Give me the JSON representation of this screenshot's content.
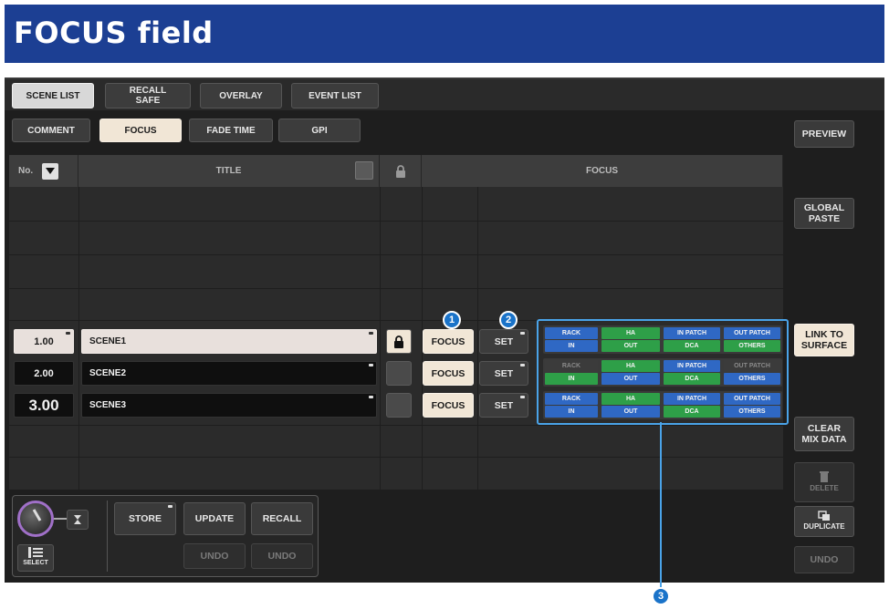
{
  "page_title": "FOCUS field",
  "tabs": [
    {
      "label": "SCENE LIST",
      "active": true
    },
    {
      "label": "RECALL\nSAFE",
      "active": false
    },
    {
      "label": "OVERLAY",
      "active": false
    },
    {
      "label": "EVENT LIST",
      "active": false
    }
  ],
  "subtabs": [
    {
      "label": "COMMENT",
      "active": false
    },
    {
      "label": "FOCUS",
      "active": true
    },
    {
      "label": "FADE TIME",
      "active": false
    },
    {
      "label": "GPI",
      "active": false
    }
  ],
  "table": {
    "col_no": "No.",
    "col_title": "TITLE",
    "col_focus": "FOCUS",
    "lock_icon": "lock-icon",
    "rows": [
      {
        "no": "1.00",
        "title": "SCENE1",
        "focus_btn": "FOCUS",
        "set_btn": "SET",
        "locked": true,
        "selected": true,
        "focus": {
          "RACK": true,
          "IN": true,
          "HA": true,
          "OUT": true,
          "IN PATCH": true,
          "DCA": true,
          "OUT PATCH": true,
          "OTHERS": true
        }
      },
      {
        "no": "2.00",
        "title": "SCENE2",
        "focus_btn": "FOCUS",
        "set_btn": "SET",
        "locked": false,
        "selected": false,
        "focus": {
          "RACK": false,
          "IN": true,
          "HA": true,
          "OUT": true,
          "IN PATCH": true,
          "DCA": true,
          "OUT PATCH": false,
          "OTHERS": true
        }
      },
      {
        "no": "3.00",
        "title": "SCENE3",
        "focus_btn": "FOCUS",
        "set_btn": "SET",
        "locked": false,
        "selected": false,
        "focus": {
          "RACK": true,
          "IN": true,
          "HA": true,
          "OUT": true,
          "IN PATCH": true,
          "DCA": true,
          "OUT PATCH": true,
          "OTHERS": true
        }
      }
    ],
    "focus_labels": {
      "rack": "RACK",
      "in": "IN",
      "ha": "HA",
      "out": "OUT",
      "in_patch": "IN PATCH",
      "dca": "DCA",
      "out_patch": "OUT PATCH",
      "others": "OTHERS"
    }
  },
  "side": {
    "preview": "PREVIEW",
    "global_paste": "GLOBAL\nPASTE",
    "link_to_surface": "LINK TO\nSURFACE",
    "clear_mix_data": "CLEAR\nMIX DATA",
    "delete": "DELETE",
    "duplicate": "DUPLICATE",
    "undo": "UNDO"
  },
  "bottom": {
    "select": "SELECT",
    "store": "STORE",
    "update": "UPDATE",
    "recall": "RECALL",
    "undo1": "UNDO",
    "undo2": "UNDO"
  },
  "callouts": {
    "one": "1",
    "two": "2",
    "three": "3"
  },
  "colors": {
    "header_blue": "#1c3f93",
    "pill_blue": "#2f68c4",
    "pill_green": "#2e9f48",
    "callout": "#1a73c9",
    "highlight": "#f1e6d6"
  }
}
